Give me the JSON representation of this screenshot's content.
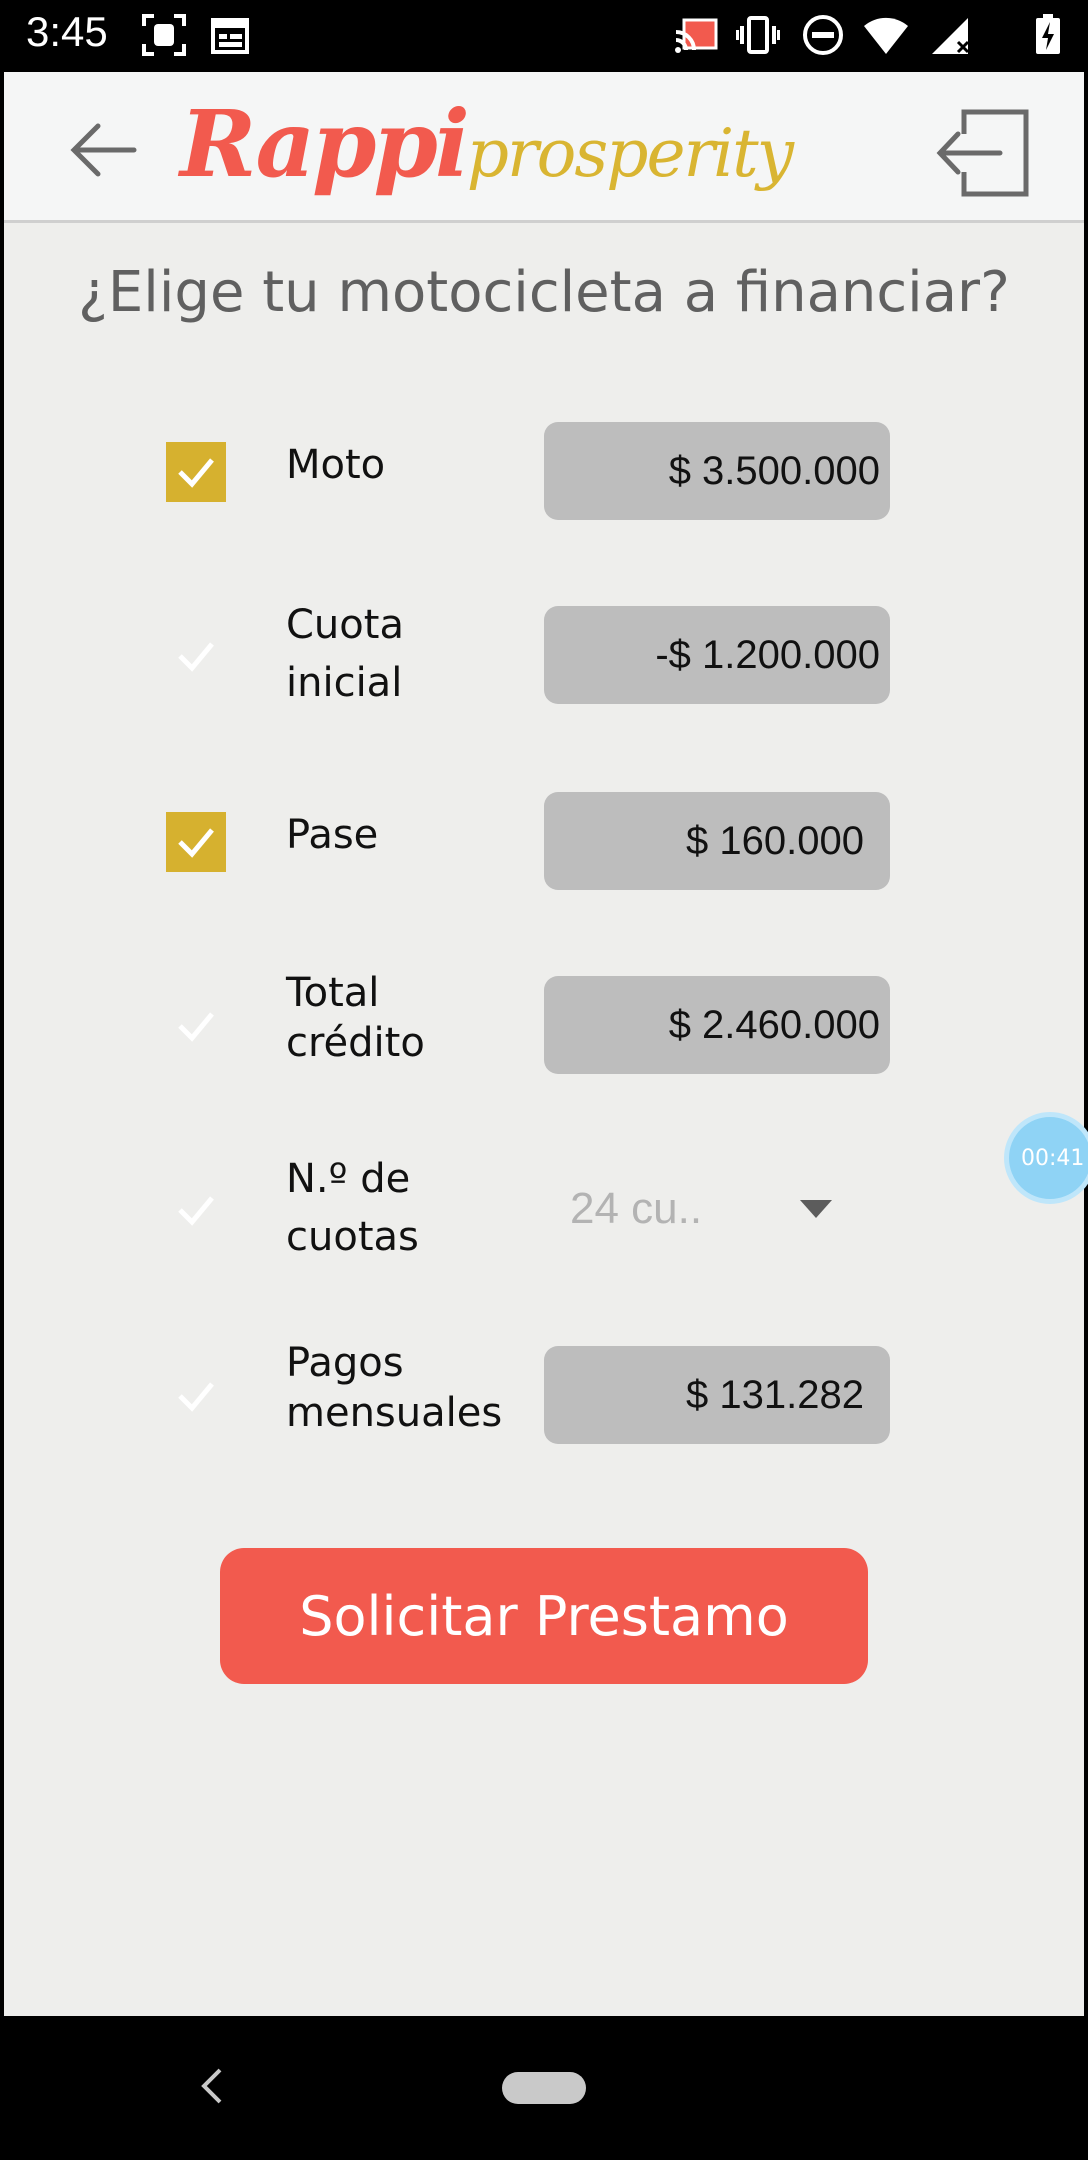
{
  "status_bar": {
    "time": "3:45",
    "icons": [
      "screenshot-icon",
      "calendar-icon",
      "cast-icon",
      "vibrate-icon",
      "do-not-disturb-icon",
      "wifi-icon",
      "signal-icon",
      "battery-charging-icon"
    ]
  },
  "header": {
    "logo_rappi": "Rappi",
    "logo_prosperity": "prosperity",
    "back_icon": "arrow-left-icon",
    "exit_icon": "logout-icon"
  },
  "page": {
    "title": "¿Elige tu motocicleta a financiar?"
  },
  "rows": [
    {
      "label": "Moto",
      "value": "$ 3.500.000",
      "checked": true
    },
    {
      "label_line1": "Cuota",
      "label_line2": "inicial",
      "value": "-$ 1.200.000",
      "checked": false
    },
    {
      "label": "Pase",
      "value": "$ 160.000",
      "checked": true
    },
    {
      "label_line1": "Total",
      "label_line2": "crédito",
      "value": "$ 2.460.000",
      "checked": false
    },
    {
      "label_line1": "N.º de",
      "label_line2": "cuotas",
      "value": "24 cu..",
      "checked": false
    },
    {
      "label_line1": "Pagos",
      "label_line2": "mensuales",
      "value": "$ 131.282",
      "checked": false
    }
  ],
  "button": {
    "label": "Solicitar Prestamo"
  },
  "timer": {
    "text": "00:41"
  },
  "colors": {
    "accent": "#f25a4e",
    "gold": "#d6b12f",
    "field": "#bdbdbd",
    "background": "#eeeeec"
  }
}
